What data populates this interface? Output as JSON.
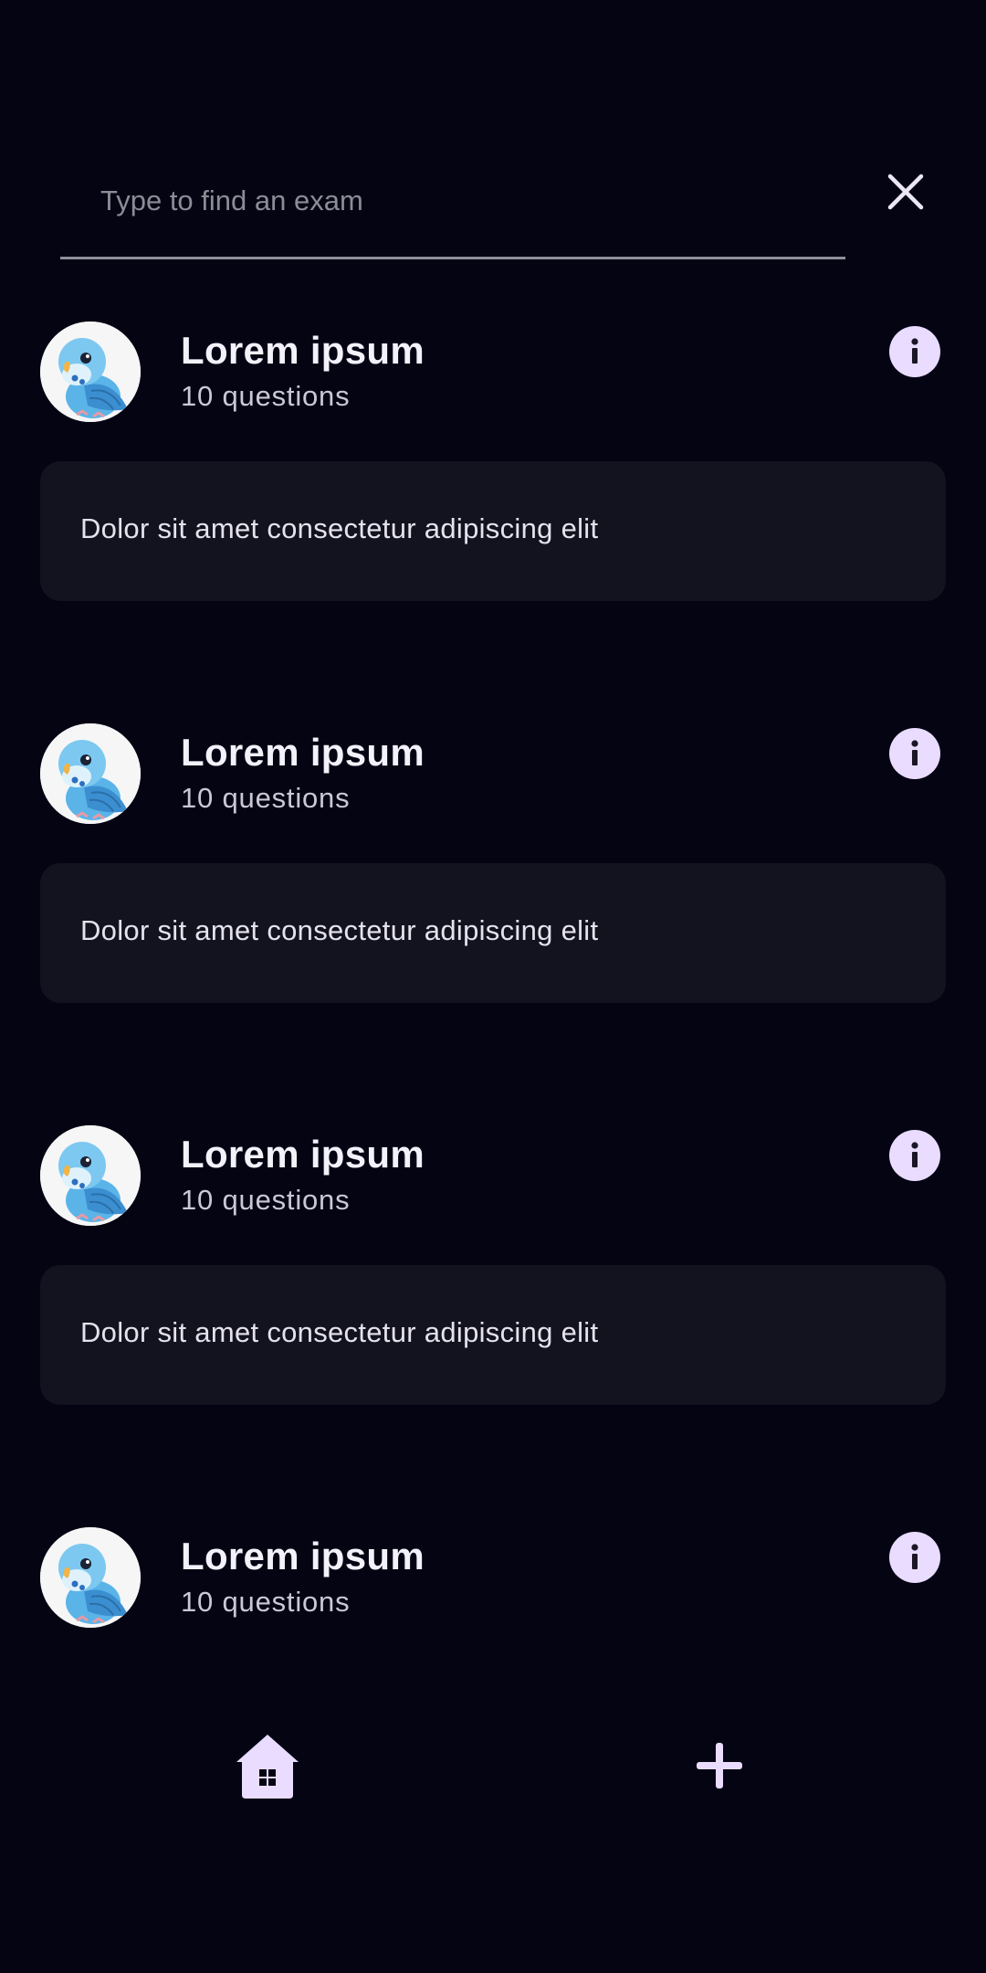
{
  "search": {
    "placeholder": "Type to find an exam",
    "value": ""
  },
  "exams": [
    {
      "title": "Lorem ipsum",
      "count": "10 questions",
      "description": "Dolor sit amet consectetur adipiscing elit",
      "avatar": "parakeet-avatar"
    },
    {
      "title": "Lorem ipsum",
      "count": "10 questions",
      "description": "Dolor sit amet consectetur adipiscing elit",
      "avatar": "parakeet-avatar"
    },
    {
      "title": "Lorem ipsum",
      "count": "10 questions",
      "description": "Dolor sit amet consectetur adipiscing elit",
      "avatar": "parakeet-avatar"
    },
    {
      "title": "Lorem ipsum",
      "count": "10 questions",
      "avatar": "parakeet-avatar"
    }
  ],
  "nav": {
    "items": [
      {
        "icon": "home-icon"
      },
      {
        "icon": "plus-icon"
      }
    ]
  },
  "colors": {
    "background": "#050413",
    "card": "#13121f",
    "accent": "#e9dcff"
  }
}
